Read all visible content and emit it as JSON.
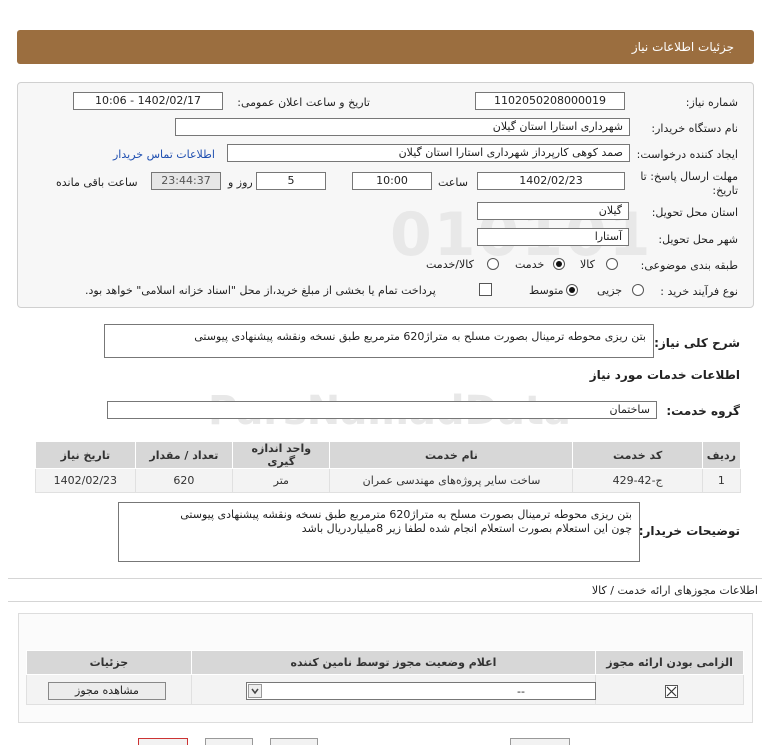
{
  "header": {
    "title": "جزئیات اطلاعات نیاز"
  },
  "form": {
    "need_number_label": "شماره نیاز:",
    "need_number": "1102050208000019",
    "announce_label": "تاریخ و ساعت اعلان عمومی:",
    "announce_value": "1402/02/17 - 10:06",
    "buyer_org_label": "نام دستگاه خریدار:",
    "buyer_org": "شهرداری استارا استان گیلان",
    "creator_label": "ایجاد کننده درخواست:",
    "creator": "صمد کوهی کارپرداز شهرداری استارا استان گیلان",
    "contact_link": "اطلاعات تماس خریدار",
    "deadline_label_1": "مهلت ارسال پاسخ: تا",
    "deadline_label_2": "تاریخ:",
    "deadline_date": "1402/02/23",
    "time_label": "ساعت",
    "deadline_time": "10:00",
    "days_value": "5",
    "days_label": "روز و",
    "remaining_time": "23:44:37",
    "remaining_label": "ساعت باقی مانده",
    "province_label": "استان محل تحویل:",
    "province": "گیلان",
    "city_label": "شهر محل تحویل:",
    "city": "آستارا",
    "category_label": "طبقه بندی موضوعی:",
    "category_options": [
      "کالا",
      "خدمت",
      "کالا/خدمت"
    ],
    "purchase_type_label": "نوع فرآیند خرید :",
    "purchase_options": [
      "جزیی",
      "متوسط"
    ],
    "payment_note": "پرداخت تمام یا بخشی از مبلغ خرید،از محل \"اسناد خزانه اسلامی\" خواهد بود."
  },
  "summary": {
    "label": "شرح کلی نیاز:",
    "text": "بتن ریزی محوطه ترمینال بصورت مسلح به متراژ620 مترمربع طبق نسخه ونقشه پیشنهادی پیوستی"
  },
  "services": {
    "title": "اطلاعات خدمات مورد نیاز",
    "group_label": "گروه خدمت:",
    "group_value": "ساختمان",
    "columns": [
      "ردیف",
      "کد خدمت",
      "نام خدمت",
      "واحد اندازه گیری",
      "تعداد / مقدار",
      "تاریخ نیاز"
    ],
    "rows": [
      [
        "1",
        "ج-42-429",
        "ساخت سایر پروژه‌های مهندسی عمران",
        "متر",
        "620",
        "1402/02/23"
      ]
    ]
  },
  "buyer_notes": {
    "label": "توضیحات خریدار:",
    "line1": "بتن ریزی محوطه ترمینال بصورت مسلح به متراژ620 مترمربع طبق نسخه ونقشه پیشنهادی پیوستی",
    "line2": "چون این استعلام بصورت استعلام انجام شده لطفا زیر 8میلیاردریال باشد"
  },
  "licenses": {
    "title": "اطلاعات مجوزهای ارائه خدمت / کالا",
    "columns": [
      "الزامی بودن ارائه مجوز",
      "اعلام وضعیت مجوز توسط نامین کننده",
      "جزئیات"
    ],
    "status_value": "--",
    "view_button": "مشاهده مجوز"
  },
  "watermark": {
    "text": "ParsNamadData"
  }
}
